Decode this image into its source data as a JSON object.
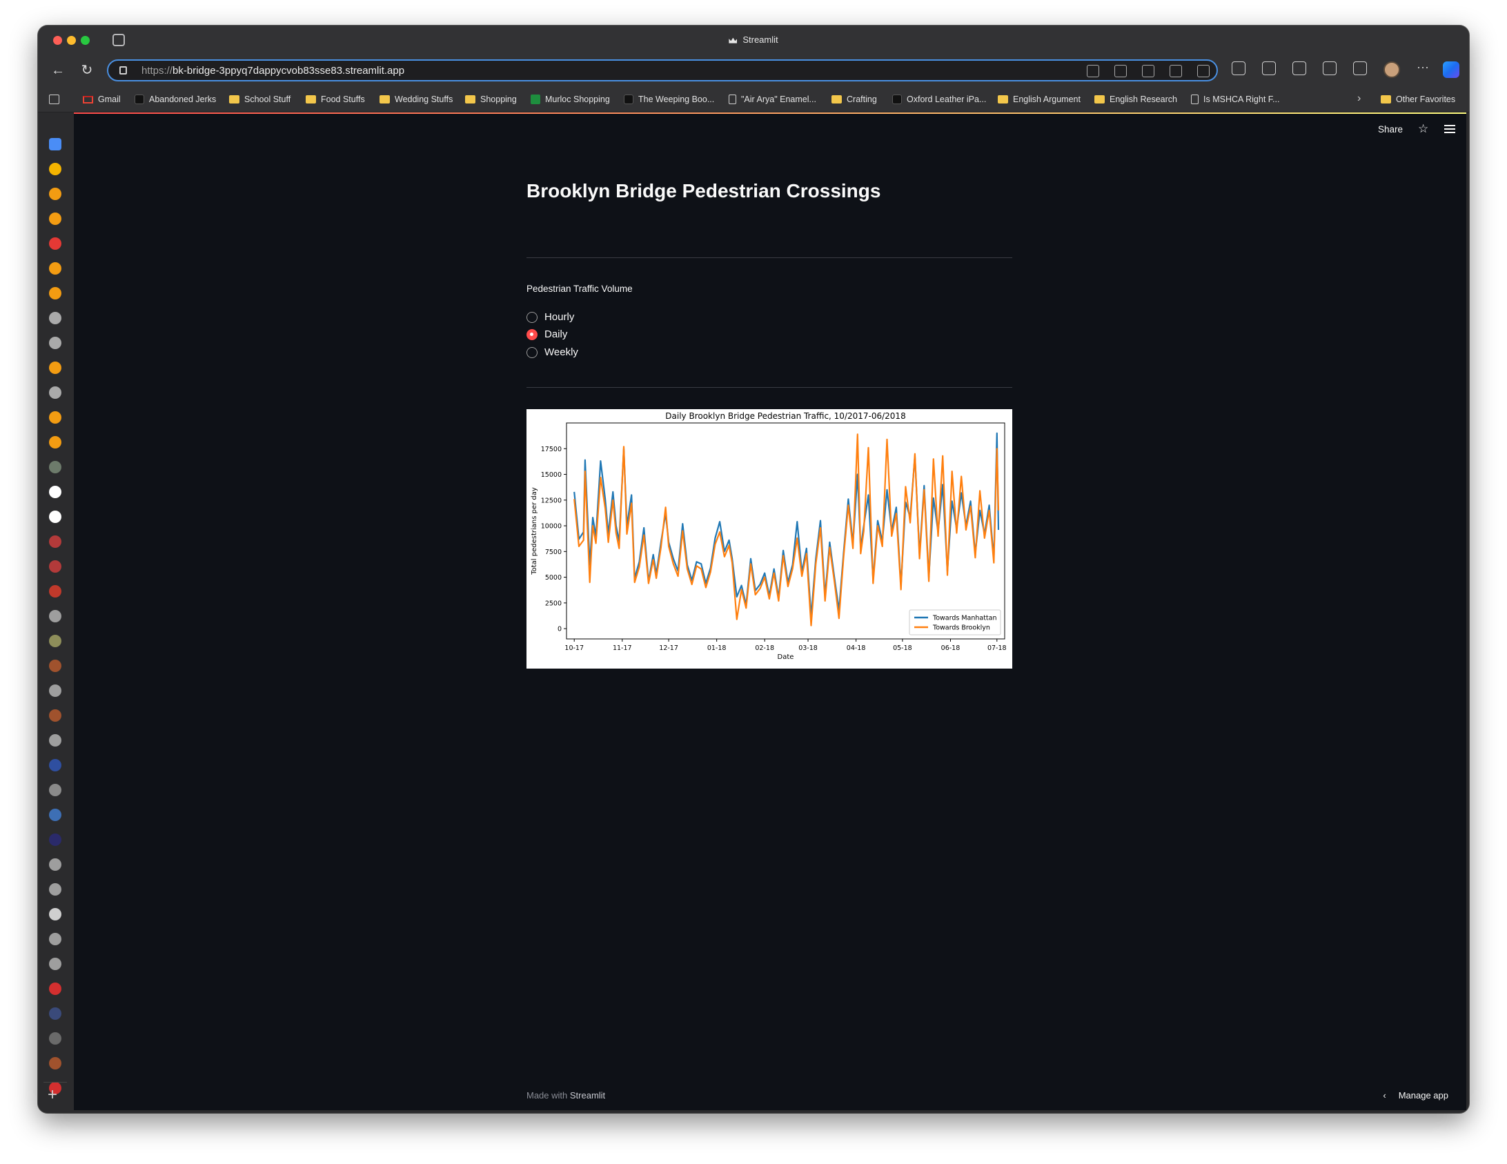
{
  "browser": {
    "window_title": "Streamlit",
    "url_protocol": "https://",
    "url_host": "bk-bridge-3ppyq7dappycvob83sse83.streamlit.app",
    "bookmarks": [
      {
        "label": "Gmail",
        "icon": "gmail-icon"
      },
      {
        "label": "Abandoned Jerks",
        "icon": "site-icon"
      },
      {
        "label": "School Stuff",
        "icon": "folder-icon"
      },
      {
        "label": "Food Stuffs",
        "icon": "folder-icon"
      },
      {
        "label": "Wedding Stuffs",
        "icon": "folder-icon"
      },
      {
        "label": "Shopping",
        "icon": "folder-icon"
      },
      {
        "label": "Murloc Shopping",
        "icon": "sheets-icon"
      },
      {
        "label": "The Weeping Boo...",
        "icon": "site-icon"
      },
      {
        "label": "\"Air Arya\" Enamel...",
        "icon": "doc-icon"
      },
      {
        "label": "Crafting",
        "icon": "folder-icon"
      },
      {
        "label": "Oxford Leather iPa...",
        "icon": "site-icon"
      },
      {
        "label": "English Argument",
        "icon": "folder-icon"
      },
      {
        "label": "English Research",
        "icon": "folder-icon"
      },
      {
        "label": "Is MSHCA Right F...",
        "icon": "doc-icon"
      }
    ],
    "other_favorites": "Other Favorites"
  },
  "app": {
    "share_label": "Share",
    "title": "Brooklyn Bridge Pedestrian Crossings",
    "radio_label": "Pedestrian Traffic Volume",
    "options": [
      "Hourly",
      "Daily",
      "Weekly"
    ],
    "selected_option": "Daily",
    "footer_prefix": "Made with ",
    "footer_brand": "Streamlit",
    "manage_app": "Manage app",
    "accent_color": "#ff4b4b",
    "background_color": "#0e1117"
  },
  "chart_data": {
    "type": "line",
    "title": "Daily Brooklyn Bridge Pedestrian Traffic, 10/2017-06/2018",
    "xlabel": "Date",
    "ylabel": "Total pedestrians per day",
    "x_tick_labels": [
      "10-17",
      "11-17",
      "12-17",
      "01-18",
      "02-18",
      "03-18",
      "04-18",
      "05-18",
      "06-18",
      "07-18"
    ],
    "x_tick_dates": [
      "2017-10-01",
      "2017-11-01",
      "2017-12-01",
      "2018-01-01",
      "2018-02-01",
      "2018-03-01",
      "2018-04-01",
      "2018-05-01",
      "2018-06-01",
      "2018-07-01"
    ],
    "y_ticks": [
      0,
      2500,
      5000,
      7500,
      10000,
      12500,
      15000,
      17500
    ],
    "xlim": [
      "2017-09-26",
      "2018-07-06"
    ],
    "ylim": [
      -1000,
      20000
    ],
    "legend_position": "lower right",
    "series": [
      {
        "name": "Towards Manhattan",
        "color": "#1f77b4",
        "points": [
          [
            "2017-10-01",
            13300
          ],
          [
            "2017-10-04",
            8700
          ],
          [
            "2017-10-07",
            9400
          ],
          [
            "2017-10-08",
            16400
          ],
          [
            "2017-10-11",
            6200
          ],
          [
            "2017-10-13",
            10800
          ],
          [
            "2017-10-15",
            9000
          ],
          [
            "2017-10-18",
            16300
          ],
          [
            "2017-10-21",
            12600
          ],
          [
            "2017-10-23",
            9200
          ],
          [
            "2017-10-26",
            13300
          ],
          [
            "2017-10-28",
            10000
          ],
          [
            "2017-10-30",
            8500
          ],
          [
            "2017-11-02",
            17500
          ],
          [
            "2017-11-04",
            10000
          ],
          [
            "2017-11-07",
            13000
          ],
          [
            "2017-11-09",
            4900
          ],
          [
            "2017-11-12",
            6500
          ],
          [
            "2017-11-15",
            9800
          ],
          [
            "2017-11-18",
            4600
          ],
          [
            "2017-11-21",
            7200
          ],
          [
            "2017-11-23",
            5300
          ],
          [
            "2017-11-26",
            8400
          ],
          [
            "2017-11-29",
            11200
          ],
          [
            "2017-12-01",
            8400
          ],
          [
            "2017-12-04",
            6800
          ],
          [
            "2017-12-07",
            5600
          ],
          [
            "2017-12-10",
            10200
          ],
          [
            "2017-12-13",
            6200
          ],
          [
            "2017-12-16",
            4700
          ],
          [
            "2017-12-19",
            6500
          ],
          [
            "2017-12-22",
            6300
          ],
          [
            "2017-12-25",
            4400
          ],
          [
            "2017-12-28",
            5900
          ],
          [
            "2017-12-31",
            8800
          ],
          [
            "2018-01-03",
            10400
          ],
          [
            "2018-01-06",
            7500
          ],
          [
            "2018-01-09",
            8600
          ],
          [
            "2018-01-11",
            6800
          ],
          [
            "2018-01-14",
            3100
          ],
          [
            "2018-01-17",
            4200
          ],
          [
            "2018-01-20",
            2300
          ],
          [
            "2018-01-23",
            6800
          ],
          [
            "2018-01-26",
            3700
          ],
          [
            "2018-01-29",
            4300
          ],
          [
            "2018-02-01",
            5400
          ],
          [
            "2018-02-04",
            3200
          ],
          [
            "2018-02-07",
            5800
          ],
          [
            "2018-02-10",
            3000
          ],
          [
            "2018-02-13",
            7600
          ],
          [
            "2018-02-16",
            4500
          ],
          [
            "2018-02-19",
            6200
          ],
          [
            "2018-02-22",
            10400
          ],
          [
            "2018-02-25",
            5500
          ],
          [
            "2018-02-28",
            7800
          ],
          [
            "2018-03-03",
            1200
          ],
          [
            "2018-03-06",
            6800
          ],
          [
            "2018-03-09",
            10500
          ],
          [
            "2018-03-12",
            3200
          ],
          [
            "2018-03-15",
            8400
          ],
          [
            "2018-03-18",
            5000
          ],
          [
            "2018-03-21",
            1800
          ],
          [
            "2018-03-24",
            7400
          ],
          [
            "2018-03-27",
            12600
          ],
          [
            "2018-03-30",
            8300
          ],
          [
            "2018-04-02",
            15000
          ],
          [
            "2018-04-04",
            7800
          ],
          [
            "2018-04-06",
            10000
          ],
          [
            "2018-04-09",
            13000
          ],
          [
            "2018-04-12",
            4800
          ],
          [
            "2018-04-15",
            10500
          ],
          [
            "2018-04-18",
            8500
          ],
          [
            "2018-04-21",
            13500
          ],
          [
            "2018-04-24",
            9500
          ],
          [
            "2018-04-27",
            11800
          ],
          [
            "2018-04-30",
            4200
          ],
          [
            "2018-05-03",
            12300
          ],
          [
            "2018-05-06",
            10800
          ],
          [
            "2018-05-09",
            16800
          ],
          [
            "2018-05-12",
            7200
          ],
          [
            "2018-05-15",
            13900
          ],
          [
            "2018-05-18",
            5000
          ],
          [
            "2018-05-21",
            12700
          ],
          [
            "2018-05-24",
            9400
          ],
          [
            "2018-05-27",
            14000
          ],
          [
            "2018-05-30",
            5600
          ],
          [
            "2018-06-02",
            12400
          ],
          [
            "2018-06-05",
            9700
          ],
          [
            "2018-06-08",
            13200
          ],
          [
            "2018-06-11",
            10000
          ],
          [
            "2018-06-14",
            12400
          ],
          [
            "2018-06-17",
            7300
          ],
          [
            "2018-06-20",
            11500
          ],
          [
            "2018-06-23",
            9200
          ],
          [
            "2018-06-26",
            12000
          ],
          [
            "2018-06-29",
            6800
          ],
          [
            "2018-07-01",
            19000
          ],
          [
            "2018-07-02",
            9600
          ]
        ]
      },
      {
        "name": "Towards Brooklyn",
        "color": "#ff7f0e",
        "points": [
          [
            "2017-10-01",
            12600
          ],
          [
            "2017-10-04",
            8000
          ],
          [
            "2017-10-07",
            8600
          ],
          [
            "2017-10-08",
            15300
          ],
          [
            "2017-10-11",
            4500
          ],
          [
            "2017-10-13",
            10000
          ],
          [
            "2017-10-15",
            8300
          ],
          [
            "2017-10-18",
            14700
          ],
          [
            "2017-10-21",
            11700
          ],
          [
            "2017-10-23",
            8400
          ],
          [
            "2017-10-26",
            12500
          ],
          [
            "2017-10-28",
            9300
          ],
          [
            "2017-10-30",
            7800
          ],
          [
            "2017-11-02",
            17700
          ],
          [
            "2017-11-04",
            9200
          ],
          [
            "2017-11-07",
            12200
          ],
          [
            "2017-11-09",
            4500
          ],
          [
            "2017-11-12",
            6000
          ],
          [
            "2017-11-15",
            9100
          ],
          [
            "2017-11-18",
            4400
          ],
          [
            "2017-11-21",
            6700
          ],
          [
            "2017-11-23",
            4900
          ],
          [
            "2017-11-26",
            7900
          ],
          [
            "2017-11-29",
            11800
          ],
          [
            "2017-12-01",
            8000
          ],
          [
            "2017-12-04",
            6300
          ],
          [
            "2017-12-07",
            5100
          ],
          [
            "2017-12-10",
            9500
          ],
          [
            "2017-12-13",
            5800
          ],
          [
            "2017-12-16",
            4300
          ],
          [
            "2017-12-19",
            6100
          ],
          [
            "2017-12-22",
            5800
          ],
          [
            "2017-12-25",
            4000
          ],
          [
            "2017-12-28",
            5500
          ],
          [
            "2017-12-31",
            8200
          ],
          [
            "2018-01-03",
            9400
          ],
          [
            "2018-01-06",
            7000
          ],
          [
            "2018-01-09",
            8100
          ],
          [
            "2018-01-11",
            6400
          ],
          [
            "2018-01-14",
            900
          ],
          [
            "2018-01-17",
            3800
          ],
          [
            "2018-01-20",
            2000
          ],
          [
            "2018-01-23",
            6300
          ],
          [
            "2018-01-26",
            3300
          ],
          [
            "2018-01-29",
            3900
          ],
          [
            "2018-02-01",
            5000
          ],
          [
            "2018-02-04",
            2900
          ],
          [
            "2018-02-07",
            5400
          ],
          [
            "2018-02-10",
            2700
          ],
          [
            "2018-02-13",
            7100
          ],
          [
            "2018-02-16",
            4100
          ],
          [
            "2018-02-19",
            5800
          ],
          [
            "2018-02-22",
            8800
          ],
          [
            "2018-02-25",
            5100
          ],
          [
            "2018-02-28",
            7300
          ],
          [
            "2018-03-03",
            300
          ],
          [
            "2018-03-06",
            6300
          ],
          [
            "2018-03-09",
            9800
          ],
          [
            "2018-03-12",
            2700
          ],
          [
            "2018-03-15",
            7900
          ],
          [
            "2018-03-18",
            4600
          ],
          [
            "2018-03-21",
            1000
          ],
          [
            "2018-03-24",
            7000
          ],
          [
            "2018-03-27",
            12000
          ],
          [
            "2018-03-30",
            7800
          ],
          [
            "2018-04-02",
            18900
          ],
          [
            "2018-04-04",
            7300
          ],
          [
            "2018-04-06",
            9500
          ],
          [
            "2018-04-09",
            17600
          ],
          [
            "2018-04-12",
            4400
          ],
          [
            "2018-04-15",
            10000
          ],
          [
            "2018-04-18",
            8000
          ],
          [
            "2018-04-21",
            18400
          ],
          [
            "2018-04-24",
            9000
          ],
          [
            "2018-04-27",
            11200
          ],
          [
            "2018-04-30",
            3800
          ],
          [
            "2018-05-03",
            13800
          ],
          [
            "2018-05-06",
            10300
          ],
          [
            "2018-05-09",
            17000
          ],
          [
            "2018-05-12",
            6800
          ],
          [
            "2018-05-15",
            13500
          ],
          [
            "2018-05-18",
            4600
          ],
          [
            "2018-05-21",
            16500
          ],
          [
            "2018-05-24",
            9000
          ],
          [
            "2018-05-27",
            16800
          ],
          [
            "2018-05-30",
            5200
          ],
          [
            "2018-06-02",
            15300
          ],
          [
            "2018-06-05",
            9300
          ],
          [
            "2018-06-08",
            14800
          ],
          [
            "2018-06-11",
            9600
          ],
          [
            "2018-06-14",
            11900
          ],
          [
            "2018-06-17",
            6900
          ],
          [
            "2018-06-20",
            13400
          ],
          [
            "2018-06-23",
            8800
          ],
          [
            "2018-06-26",
            11500
          ],
          [
            "2018-06-29",
            6400
          ],
          [
            "2018-07-01",
            17500
          ],
          [
            "2018-07-02",
            11500
          ]
        ]
      }
    ]
  }
}
